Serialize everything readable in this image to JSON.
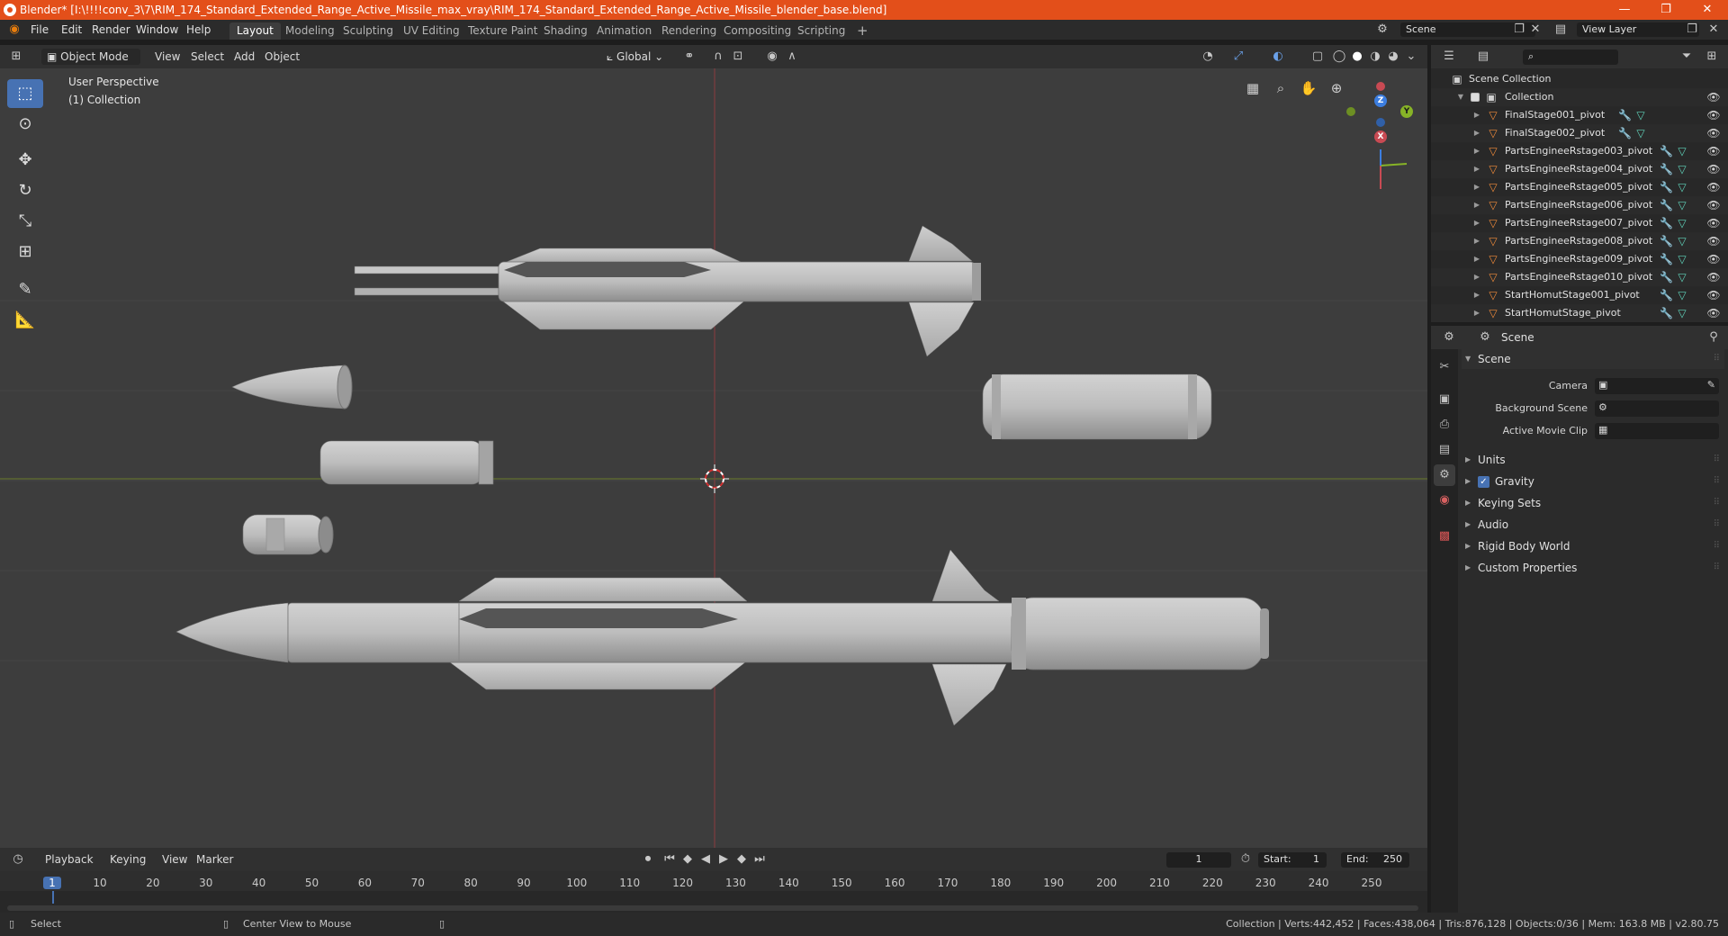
{
  "title_bar": {
    "title": "Blender* [I:\\!!!!conv_3\\7\\RIM_174_Standard_Extended_Range_Active_Missile_max_vray\\RIM_174_Standard_Extended_Range_Active_Missile_blender_base.blend]",
    "minimize": "—",
    "maximize": "❐",
    "close": "✕"
  },
  "menu": {
    "items": [
      "File",
      "Edit",
      "Render",
      "Window",
      "Help"
    ],
    "workspaces": [
      "Layout",
      "Modeling",
      "Sculpting",
      "UV Editing",
      "Texture Paint",
      "Shading",
      "Animation",
      "Rendering",
      "Compositing",
      "Scripting"
    ],
    "active_workspace": "Layout",
    "add_workspace": "+",
    "scene_label": "Scene",
    "view_layer_label": "View Layer"
  },
  "viewport_header": {
    "mode": "Object Mode",
    "menus": [
      "View",
      "Select",
      "Add",
      "Object"
    ],
    "transform_orientation": "Global"
  },
  "viewport": {
    "perspective_label": "User Perspective",
    "collection_label": "(1) Collection",
    "gizmo": {
      "z": "Z",
      "y": "Y",
      "x": "X"
    },
    "colors": {
      "background": "#3d3d3d",
      "x_axis": "#c84a53",
      "y_axis": "#87b327",
      "z_axis": "#3c7ee0",
      "grid": "#454545",
      "model": "#b9b9b9"
    }
  },
  "timeline": {
    "menus": [
      "Playback",
      "Keying",
      "View",
      "Marker"
    ],
    "current_frame": "1",
    "start_label": "Start:",
    "start_value": "1",
    "end_label": "End:",
    "end_value": "250",
    "ruler": [
      "1",
      "10",
      "20",
      "30",
      "40",
      "50",
      "60",
      "70",
      "80",
      "90",
      "100",
      "110",
      "120",
      "130",
      "140",
      "150",
      "160",
      "170",
      "180",
      "190",
      "200",
      "210",
      "220",
      "230",
      "240",
      "250"
    ]
  },
  "status_bar": {
    "left_action": "Select",
    "middle_action": "Center View to Mouse",
    "stats": "Collection | Verts:442,452 | Faces:438,064 | Tris:876,128 | Objects:0/36 | Mem: 163.8 MB | v2.80.75"
  },
  "outliner": {
    "scene_collection": "Scene Collection",
    "collection": "Collection",
    "items": [
      {
        "name": "FinalStage001_pivot"
      },
      {
        "name": "FinalStage002_pivot"
      },
      {
        "name": "PartsEngineeRstage003_pivot"
      },
      {
        "name": "PartsEngineeRstage004_pivot"
      },
      {
        "name": "PartsEngineeRstage005_pivot"
      },
      {
        "name": "PartsEngineeRstage006_pivot"
      },
      {
        "name": "PartsEngineeRstage007_pivot"
      },
      {
        "name": "PartsEngineeRstage008_pivot"
      },
      {
        "name": "PartsEngineeRstage009_pivot"
      },
      {
        "name": "PartsEngineeRstage010_pivot"
      },
      {
        "name": "StartHomutStage001_pivot"
      },
      {
        "name": "StartHomutStage_pivot"
      }
    ]
  },
  "properties": {
    "context": "Scene",
    "scene_panel": "Scene",
    "camera_label": "Camera",
    "background_scene_label": "Background Scene",
    "active_movie_clip_label": "Active Movie Clip",
    "panels": [
      "Units",
      "Gravity",
      "Keying Sets",
      "Audio",
      "Rigid Body World",
      "Custom Properties"
    ],
    "gravity_checked": true
  }
}
